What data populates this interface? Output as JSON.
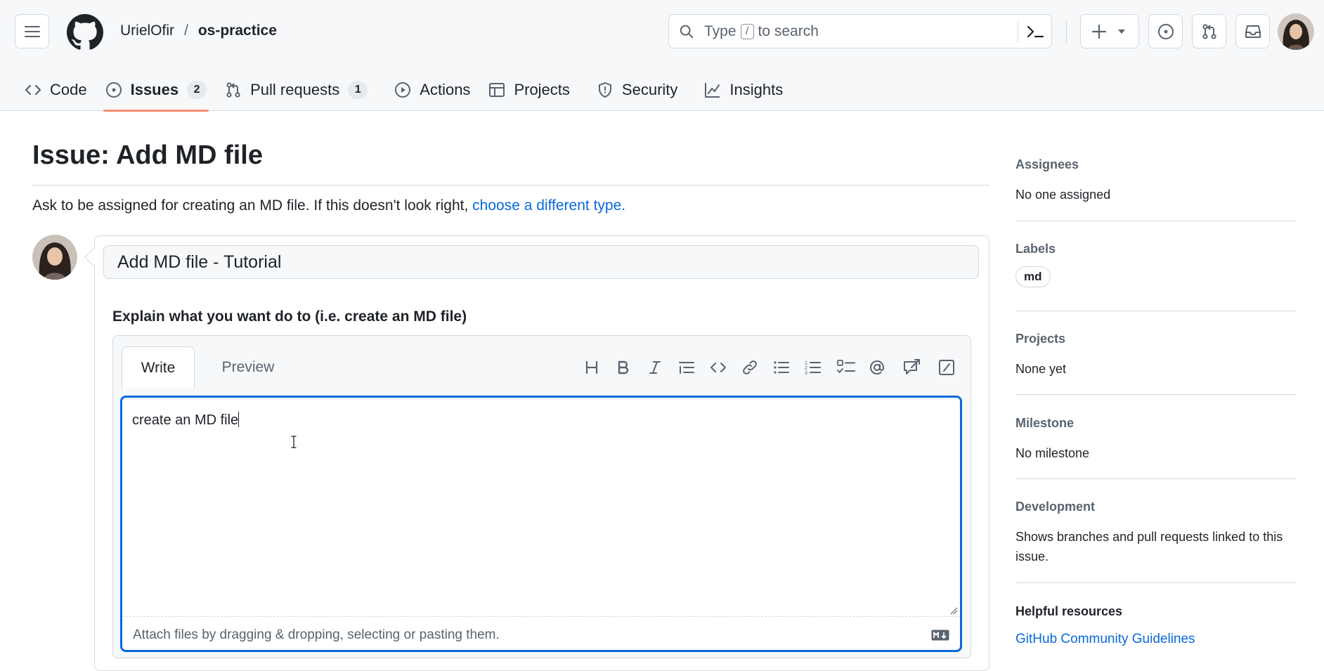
{
  "header": {
    "owner": "UrielOfir",
    "separator": "/",
    "repo": "os-practice",
    "search_prefix": "Type",
    "search_key": "/",
    "search_suffix": "to search"
  },
  "tabs": [
    {
      "label": "Code",
      "icon": "code-icon"
    },
    {
      "label": "Issues",
      "icon": "issue-opened-icon",
      "count": "2",
      "active": true
    },
    {
      "label": "Pull requests",
      "icon": "git-pull-request-icon",
      "count": "1"
    },
    {
      "label": "Actions",
      "icon": "play-icon"
    },
    {
      "label": "Projects",
      "icon": "table-icon"
    },
    {
      "label": "Security",
      "icon": "shield-icon"
    },
    {
      "label": "Insights",
      "icon": "graph-icon"
    }
  ],
  "main": {
    "title": "Issue: Add MD file",
    "description": "Ask to be assigned for creating an MD file. If this doesn't look right,",
    "description_link": "choose a different type.",
    "title_input_value": "Add MD file - Tutorial",
    "field_label": "Explain what you want do to (i.e. create an MD file)",
    "editor": {
      "write_tab": "Write",
      "preview_tab": "Preview",
      "body_value": "create an MD file",
      "attach_hint": "Attach files by dragging & dropping, selecting or pasting them."
    }
  },
  "sidebar": {
    "assignees_heading": "Assignees",
    "assignees_value": "No one assigned",
    "labels_heading": "Labels",
    "label_name": "md",
    "projects_heading": "Projects",
    "projects_value": "None yet",
    "milestone_heading": "Milestone",
    "milestone_value": "No milestone",
    "development_heading": "Development",
    "development_value": "Shows branches and pull requests linked to this issue.",
    "resources_heading": "Helpful resources",
    "resources_link": "GitHub Community Guidelines"
  },
  "colors": {
    "accent": "#0969da",
    "tab_underline": "#fd8c73",
    "border": "#d1d9e0",
    "muted_text": "#59636e"
  }
}
